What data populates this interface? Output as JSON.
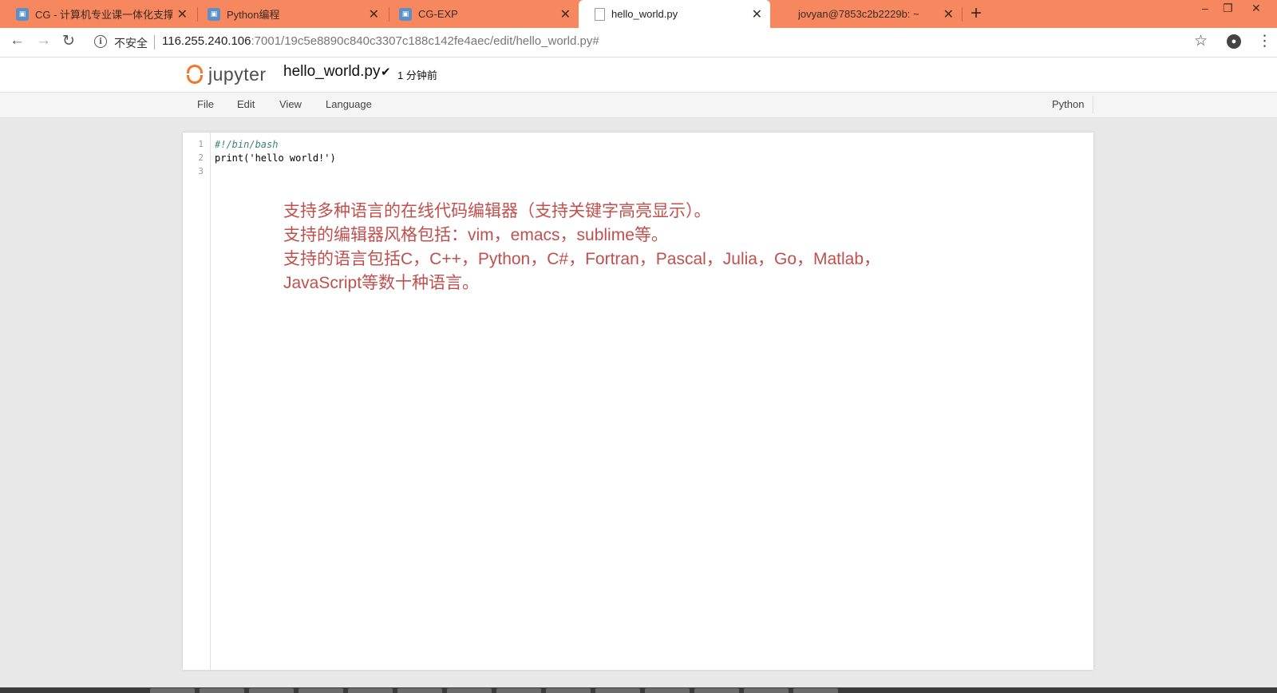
{
  "tabs": [
    {
      "title": "CG - 计算机专业课一体化支撑平",
      "icon": "jupyter-favicon",
      "active": false
    },
    {
      "title": "Python编程",
      "icon": "jupyter-favicon",
      "active": false
    },
    {
      "title": "CG-EXP",
      "icon": "jupyter-favicon",
      "active": false
    },
    {
      "title": "hello_world.py",
      "icon": "page-icon",
      "active": true
    },
    {
      "title": "jovyan@7853c2b2229b: ~",
      "icon": "terminal-icon",
      "active": false
    }
  ],
  "tab_close_symbol": "✕",
  "new_tab_symbol": "+",
  "address": {
    "security_label": "不安全",
    "host": "116.255.240.106",
    "path": ":7001/19c5e8890c840c3307c188c142fe4aec/edit/hello_world.py#"
  },
  "jupyter": {
    "logo_text": "jupyter",
    "filename": "hello_world.py",
    "save_mark": "✔",
    "save_time": "1 分钟前"
  },
  "menu": {
    "items": [
      "File",
      "Edit",
      "View",
      "Language"
    ],
    "language": "Python"
  },
  "editor": {
    "line_numbers": [
      "1",
      "2",
      "3"
    ],
    "lines": [
      "#!/bin/bash",
      "print('hello world!')",
      ""
    ]
  },
  "annotation": {
    "lines": [
      "支持多种语言的在线代码编辑器（支持关键字高亮显示）。",
      "支持的编辑器风格包括：vim，emacs，sublime等。",
      "支持的语言包括C，C++，Python，C#，Fortran，Pascal，Julia，Go，Matlab，",
      "JavaScript等数十种语言。"
    ],
    "color": "#c0504d"
  },
  "colors": {
    "tabstrip": "#f7875e",
    "jupyter_orange": "#f37726"
  }
}
